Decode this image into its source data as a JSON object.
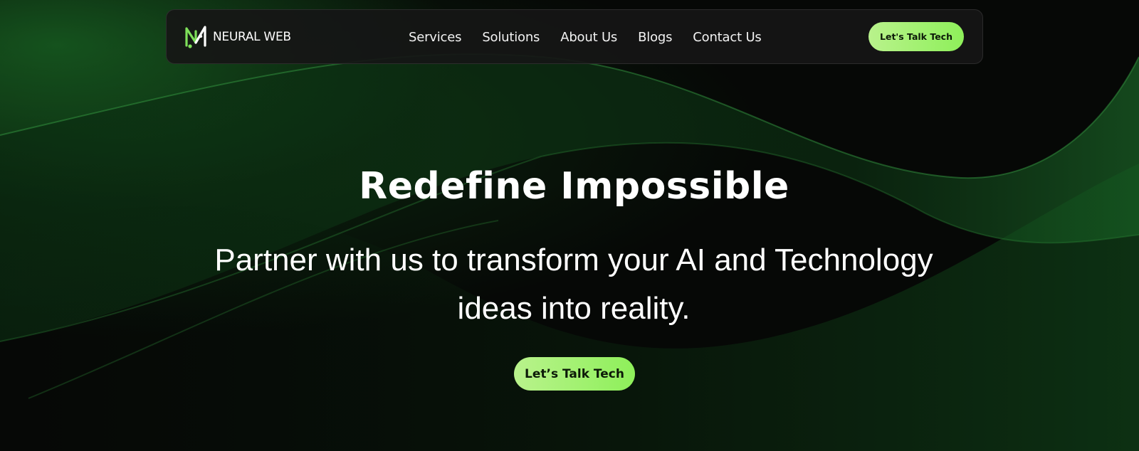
{
  "colors": {
    "background": "#060806",
    "accent": "#9ef26e",
    "wave": "#1d6b2a",
    "text": "#ffffff"
  },
  "header": {
    "logo_text": "NEURAL WEB",
    "logo_icon": "nw-logo-icon",
    "nav": [
      "Services",
      "Solutions",
      "About Us",
      "Blogs",
      "Contact Us"
    ],
    "cta_label": "Let's Talk Tech"
  },
  "hero": {
    "title": "Redefine Impossible",
    "subtitle": "Partner with us to transform your AI and Technology ideas into reality.",
    "cta_label": "Let’s Talk Tech"
  }
}
